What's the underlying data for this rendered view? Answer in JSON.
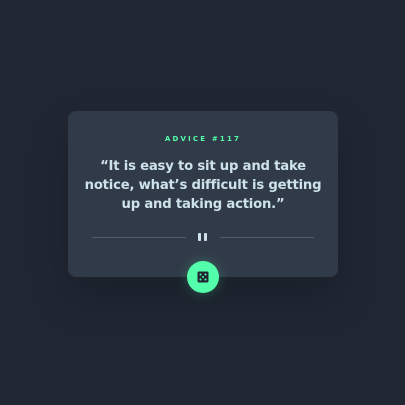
{
  "advice": {
    "id_label": "ADVICE #117",
    "quote": "“It is easy to sit up and take notice, what’s difficult is getting up and taking action.”"
  },
  "icons": {
    "divider": "pause-icon",
    "button": "dice-icon"
  },
  "colors": {
    "background": "#202733",
    "card": "#313A48",
    "accent": "#53FFAA",
    "text": "#CEE3E9",
    "divider": "#4F5D74"
  }
}
